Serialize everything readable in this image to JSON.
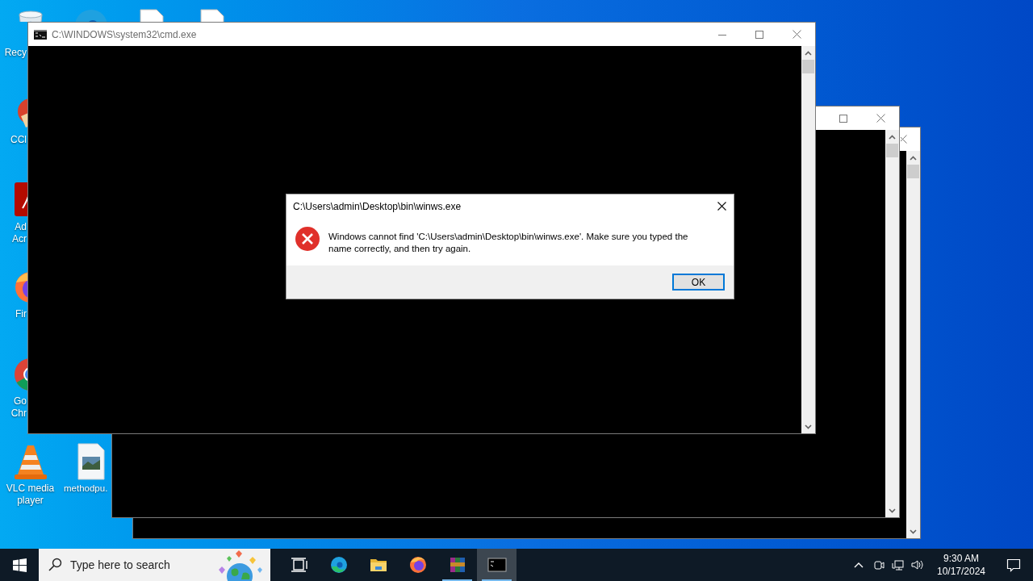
{
  "desktop_icons": [
    {
      "kind": "recycle-bin",
      "label_lines": [
        "Recy"
      ]
    },
    {
      "kind": "browser-edge"
    },
    {
      "kind": "document"
    },
    {
      "kind": "document"
    },
    {
      "kind": "cleaner",
      "label_lines": [
        "CCl"
      ]
    },
    {
      "kind": "pdf-reader",
      "label_lines": [
        "Ad",
        "Acr"
      ]
    },
    {
      "kind": "browser-fox",
      "label_lines": [
        "Fir"
      ]
    },
    {
      "kind": "browser-chrome",
      "label_lines": [
        "Go",
        "Chr"
      ]
    },
    {
      "kind": "media-player",
      "label_lines": [
        "VLC media",
        "player"
      ]
    },
    {
      "kind": "image-file",
      "label_lines": [
        "methodpu."
      ]
    }
  ],
  "console_window": {
    "title": "C:\\WINDOWS\\system32\\cmd.exe"
  },
  "dialog": {
    "title": "C:\\Users\\admin\\Desktop\\bin\\winws.exe",
    "message": "Windows cannot find 'C:\\Users\\admin\\Desktop\\bin\\winws.exe'. Make sure you typed the name correctly, and then try again.",
    "buttons": [
      {
        "label": "OK",
        "default": true
      }
    ]
  },
  "taskbar": {
    "search": {
      "placeholder": "Type here to search"
    },
    "apps": [
      {
        "kind": "task-view",
        "running": false,
        "active": false
      },
      {
        "kind": "browser-edge",
        "running": false,
        "active": false
      },
      {
        "kind": "folder",
        "running": false,
        "active": false
      },
      {
        "kind": "browser-fox",
        "running": false,
        "active": false
      },
      {
        "kind": "archiver",
        "running": true,
        "active": false
      },
      {
        "kind": "console",
        "running": true,
        "active": true
      }
    ],
    "clock": {
      "time": "9:30 AM",
      "date": "10/17/2024"
    }
  }
}
